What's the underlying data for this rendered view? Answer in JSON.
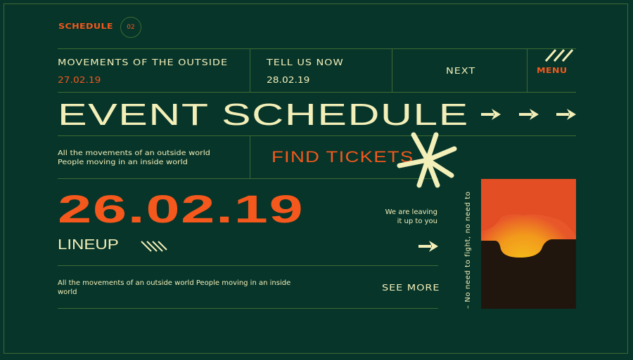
{
  "header": {
    "section_label": "SCHEDULE",
    "section_number": "02"
  },
  "nav": {
    "items": [
      {
        "title": "MOVEMENTS OF THE OUTSIDE",
        "date": "27.02.19"
      },
      {
        "title": "TELL US NOW",
        "date": "28.02.19"
      }
    ],
    "next_label": "NEXT",
    "menu_label": "MENU"
  },
  "hero": {
    "title": "EVENT SCHEDULE",
    "arrows": [
      "arrow-right-icon",
      "arrow-right-icon",
      "arrow-right-icon"
    ]
  },
  "intro": {
    "line1": "All the movements of an outside world",
    "line2": "People moving in an inside world",
    "cta_label": "FIND TICKETS"
  },
  "event": {
    "date": "26.02.19",
    "lineup_label": "LINEUP",
    "side_text_line1": "We are leaving",
    "side_text_line2": "it up to you",
    "description": "All the movements of an outside world People moving in an inside world",
    "see_more_label": "SEE MORE"
  },
  "aside": {
    "vertical_text": "– No need to fight, no need to"
  },
  "colors": {
    "background": "#07352a",
    "accent": "#f4581c",
    "text": "#f3efb8",
    "lines": "#3d6a34"
  }
}
